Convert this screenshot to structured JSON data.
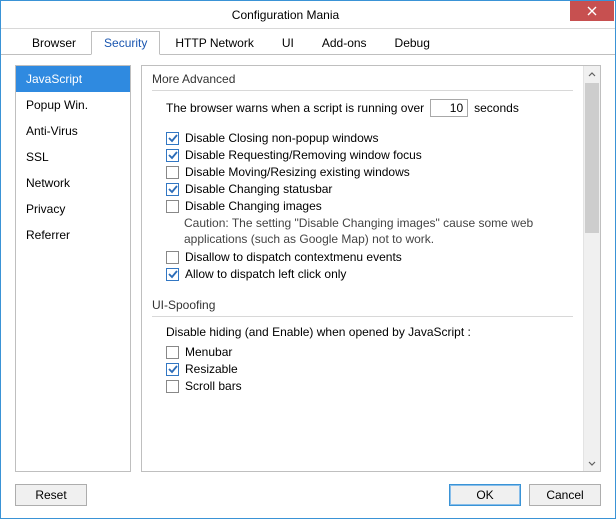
{
  "window": {
    "title": "Configuration Mania"
  },
  "tabs": [
    "Browser",
    "Security",
    "HTTP Network",
    "UI",
    "Add-ons",
    "Debug"
  ],
  "sidebar": {
    "items": [
      "JavaScript",
      "Popup Win.",
      "Anti-Virus",
      "SSL",
      "Network",
      "Privacy",
      "Referrer"
    ]
  },
  "content": {
    "group1": {
      "title": "More Advanced",
      "warn_pre": "The browser warns when a script is running over",
      "warn_value": "10",
      "warn_post": "seconds",
      "opts": [
        {
          "label": "Disable Closing non-popup windows",
          "checked": true
        },
        {
          "label": "Disable Requesting/Removing window focus",
          "checked": true
        },
        {
          "label": "Disable Moving/Resizing existing windows",
          "checked": false
        },
        {
          "label": "Disable Changing statusbar",
          "checked": true
        },
        {
          "label": "Disable Changing images",
          "checked": false
        }
      ],
      "caution": "Caution: The setting \"Disable Changing images\" cause some web applications (such as Google Map) not to work.",
      "opts2": [
        {
          "label": "Disallow to dispatch contextmenu events",
          "checked": false
        },
        {
          "label": "Allow to dispatch left click only",
          "checked": true
        }
      ]
    },
    "group2": {
      "title": "UI-Spoofing",
      "intro": "Disable hiding (and Enable) when opened by JavaScript :",
      "opts": [
        {
          "label": "Menubar",
          "checked": false
        },
        {
          "label": "Resizable",
          "checked": true
        },
        {
          "label": "Scroll bars",
          "checked": false
        }
      ]
    }
  },
  "footer": {
    "reset": "Reset",
    "ok": "OK",
    "cancel": "Cancel"
  }
}
